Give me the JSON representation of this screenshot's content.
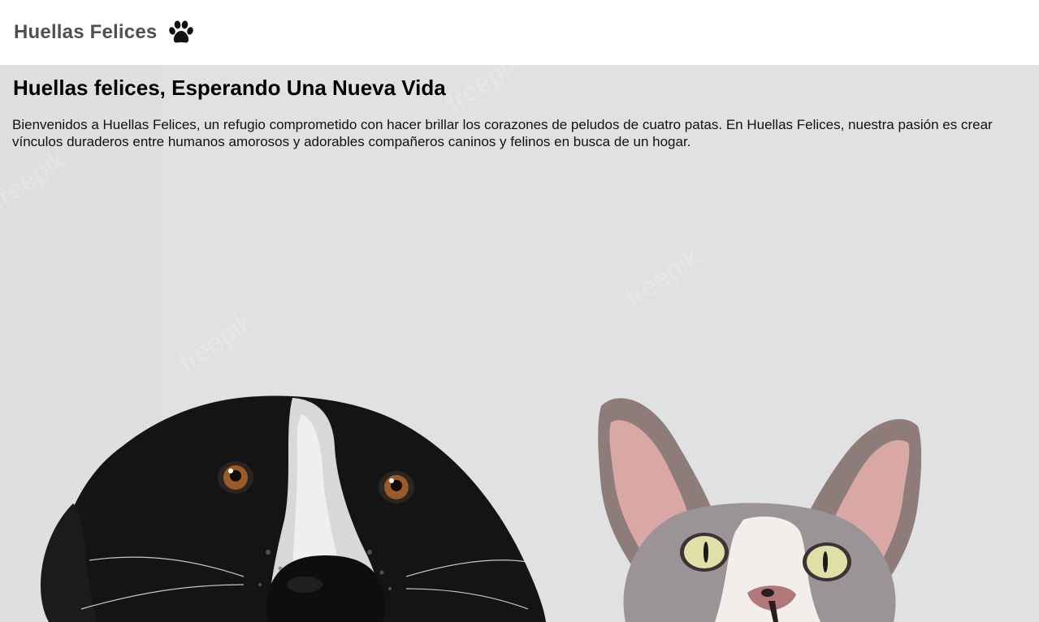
{
  "navbar": {
    "brand_label": "Huellas Felices",
    "brand_icon": "paw-icon"
  },
  "hero": {
    "title": "Huellas felices, Esperando Una Nueva Vida",
    "description": "Bienvenidos a Huellas Felices, un refugio comprometido con hacer brillar los corazones de peludos de cuatro patas. En Huellas Felices, nuestra pasión es crear vínculos duraderos entre humanos amorosos y adorables compañeros caninos y felinos en busca de un hogar.",
    "image_subjects": [
      "dog",
      "cat"
    ]
  },
  "colors": {
    "navbar_bg": "#ffffff",
    "brand_text": "#505050",
    "hero_bg": "#e0e1e3"
  }
}
